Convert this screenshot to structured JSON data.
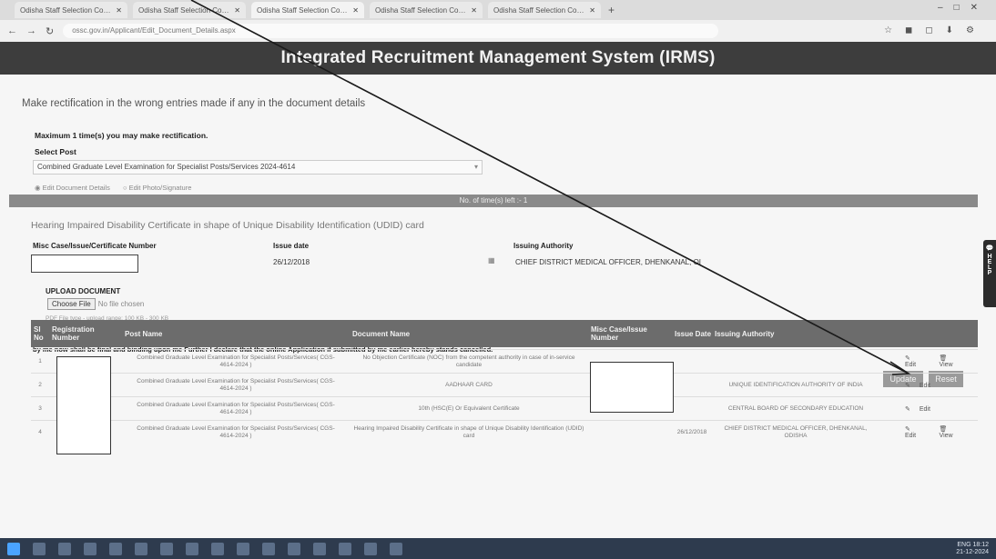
{
  "browser": {
    "tabs": [
      {
        "title": "Odisha Staff Selection Commis"
      },
      {
        "title": "Odisha Staff Selection Commis"
      },
      {
        "title": "Odisha Staff Selection Commis"
      },
      {
        "title": "Odisha Staff Selection Commis"
      },
      {
        "title": "Odisha Staff Selection Commis"
      }
    ],
    "new_tab": "+",
    "url": "ossc.gov.in/Applicant/Edit_Document_Details.aspx"
  },
  "header": {
    "title": "Integrated Recruitment Management System (IRMS)"
  },
  "intro": "Make rectification in the wrong entries made if any in the document details",
  "max_times": "Maximum 1 time(s) you may make rectification.",
  "select_post": {
    "label": "Select Post",
    "value": "Combined Graduate Level Examination for Specialist Posts/Services 2024-4614"
  },
  "edit_options": [
    "Edit Document Details",
    "Edit Photo/Signature"
  ],
  "times_left": "No. of time(s) left :- 1",
  "certificate_title": "Hearing Impaired Disability Certificate in shape of Unique Disability Identification (UDID) card",
  "fields": {
    "misc_label": "Misc Case/Issue/Certificate Number",
    "issue_date_label": "Issue date",
    "issue_date_value": "26/12/2018",
    "authority_label": "Issuing Authority",
    "authority_value": "CHIEF DISTRICT MEDICAL OFFICER, DHENKANAL, OI"
  },
  "upload": {
    "label": "UPLOAD DOCUMENT",
    "button": "Choose File",
    "no_file": "No file chosen",
    "hint": "PDF File type - upload range: 100 KB - 300 KB"
  },
  "declaration": "In spite of being given adequate facilities of previewing and editing the online Registration and Application data, I have submitted some incorrect data I undertake that I shall at my own risk want to rectify the wrong entries once for all I further agree that the modified data to be submitted by me now shall be final and binding upon me Further I declare that the online Application if submitted by me earlier hereby stands cancelled.",
  "buttons": {
    "update": "Update",
    "reset": "Reset"
  },
  "table": {
    "headers": [
      "Sl No",
      "Registration Number",
      "Post Name",
      "Document Name",
      "Misc Case/Issue Number",
      "Issue Date",
      "Issuing Authority"
    ],
    "rows": [
      {
        "sl": "1",
        "post": "Combined Graduate Level Examination for Specialist Posts/Services( CGS-4614-2024 )",
        "doc": "No Objection Certificate (NOC) from the competent authority in case of in-service candidate",
        "date": "",
        "authority": "",
        "actions": [
          "Edit",
          "View"
        ]
      },
      {
        "sl": "2",
        "post": "Combined Graduate Level Examination for Specialist Posts/Services( CGS-4614-2024 )",
        "doc": "AADHAAR CARD",
        "date": "",
        "authority": "UNIQUE IDENTIFICATION AUTHORITY OF INDIA",
        "actions": [
          "Edit"
        ]
      },
      {
        "sl": "3",
        "post": "Combined Graduate Level Examination for Specialist Posts/Services( CGS-4614-2024 )",
        "doc": "10th (HSC(E) Or Equivalent Certificate",
        "date": "",
        "authority": "CENTRAL BOARD OF SECONDARY EDUCATION",
        "actions": [
          "Edit"
        ]
      },
      {
        "sl": "4",
        "post": "Combined Graduate Level Examination for Specialist Posts/Services( CGS-4614-2024 )",
        "doc": "Hearing Impaired Disability Certificate in shape of Unique Disability Identification (UDID) card",
        "date": "26/12/2018",
        "authority": "CHIEF DISTRICT MEDICAL OFFICER, DHENKANAL, ODISHA",
        "actions": [
          "Edit",
          "View"
        ]
      }
    ]
  },
  "help_tab": "HELP",
  "taskbar": {
    "time": "18:12",
    "date": "21-12-2024",
    "lang": "ENG"
  },
  "colors": {
    "banner": "#3d3d3d",
    "table_header": "#6c6c6c",
    "button": "#9a9a9a"
  }
}
